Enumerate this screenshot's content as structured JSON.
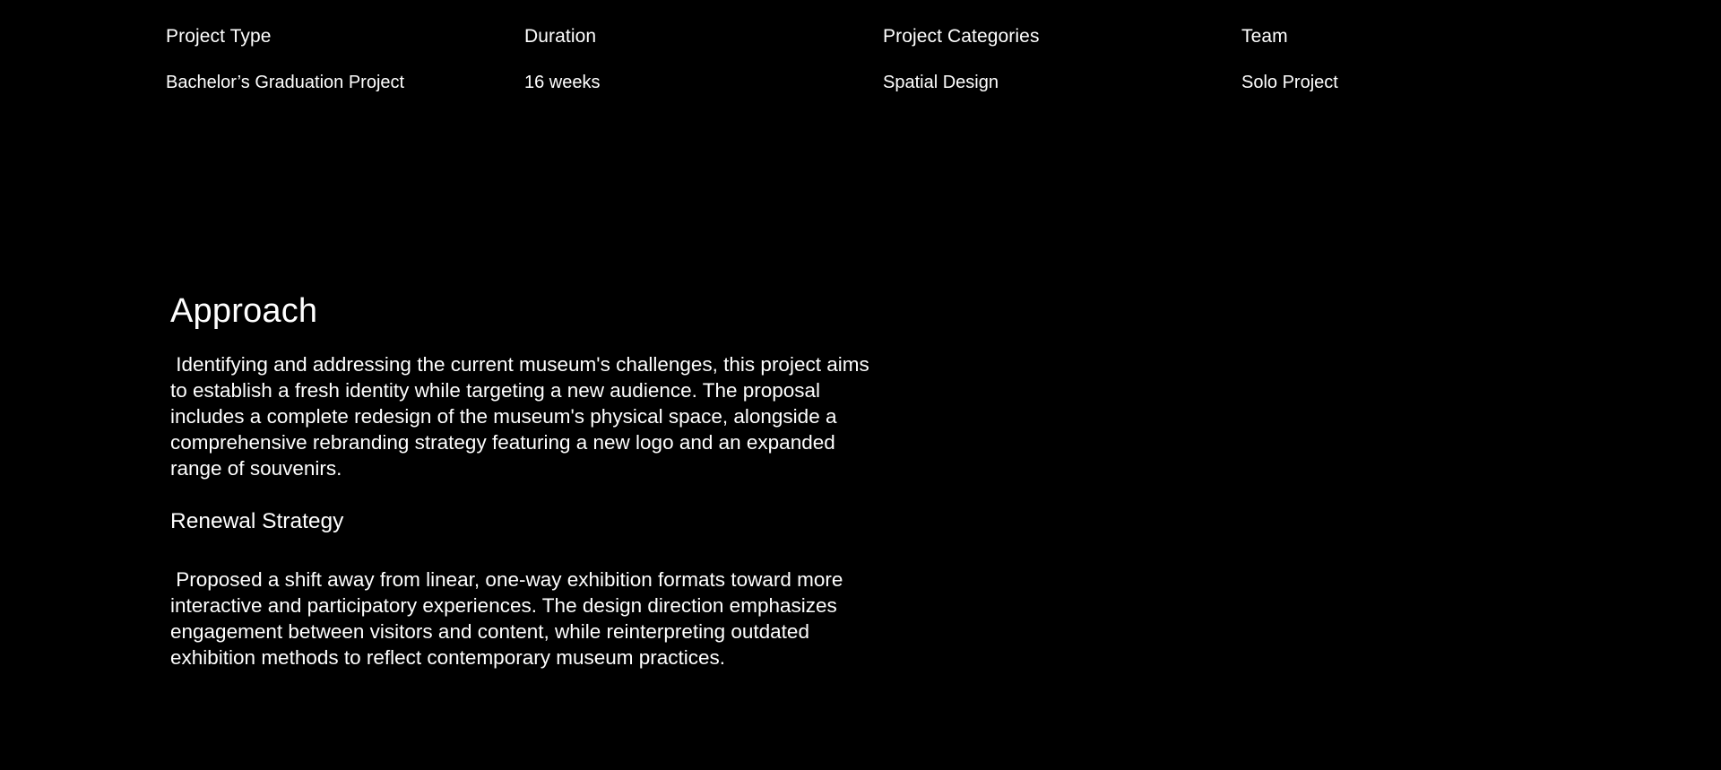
{
  "meta": {
    "columns": [
      {
        "label": "Project Type",
        "value": "Bachelor’s Graduation Project"
      },
      {
        "label": "Duration",
        "value": "16 weeks"
      },
      {
        "label": "Project Categories",
        "value": "Spatial Design"
      },
      {
        "label": "Team",
        "value": "Solo Project"
      }
    ]
  },
  "approach": {
    "title": "Approach",
    "body": " Identifying and addressing the current museum's challenges, this project aims\nto establish a fresh identity while targeting a new audience. The proposal\nincludes a complete redesign of the museum's physical space, alongside a\ncomprehensive rebranding strategy featuring a new logo and an expanded\nrange of souvenirs."
  },
  "renewal_strategy": {
    "title": "Renewal Strategy",
    "body": " Proposed a shift away from linear, one-way exhibition formats toward more\ninteractive and participatory experiences. The design direction emphasizes\nengagement between visitors and content, while reinterpreting outdated\nexhibition methods to reflect contemporary museum practices."
  },
  "colors": {
    "background": "#000000",
    "text": "#ffffff"
  }
}
